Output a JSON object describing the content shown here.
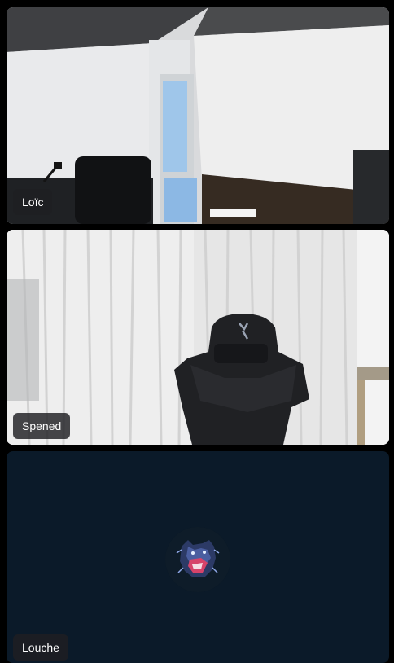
{
  "participants": [
    {
      "name": "Loïc",
      "video": "camera-on"
    },
    {
      "name": "Spened",
      "video": "camera-on"
    },
    {
      "name": "Louche",
      "video": "camera-off",
      "avatar": "bear-icon"
    }
  ],
  "colors": {
    "background": "#000000",
    "label_bg": "#1e1f22",
    "avatar_tile_bg": "#0b1a29"
  }
}
